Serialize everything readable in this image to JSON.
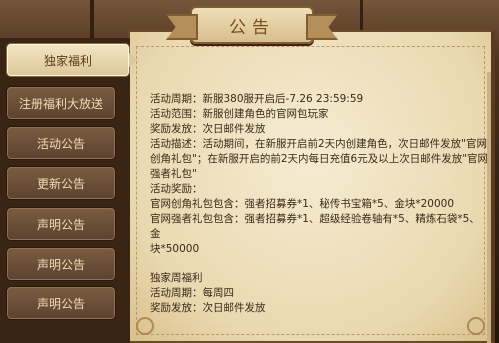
{
  "title": "公告",
  "sidebar": {
    "items": [
      {
        "label": "独家福利",
        "active": true
      },
      {
        "label": "注册福利大放送",
        "active": false
      },
      {
        "label": "活动公告",
        "active": false
      },
      {
        "label": "更新公告",
        "active": false
      },
      {
        "label": "声明公告",
        "active": false
      },
      {
        "label": "声明公告",
        "active": false
      },
      {
        "label": "声明公告",
        "active": false
      }
    ]
  },
  "content": {
    "lines": [
      "活动周期：新服380服开启后-7.26 23:59:59",
      "活动范围：新服创建角色的官网包玩家",
      "奖励发放：次日邮件发放",
      "活动描述：活动期间，在新服开启前2天内创建角色，次日邮件发放\"官网",
      "创角礼包\"；在新服开启的前2天内每日充值6元及以上次日邮件发放\"官网",
      "强者礼包\"",
      "活动奖励：",
      "官网创角礼包包含：强者招募券*1、秘传书宝箱*5、金块*20000",
      "官网强者礼包包含：强者招募券*1、超级经验卷轴有*5、精炼石袋*5、金",
      "块*50000"
    ],
    "lines2": [
      "独家周福利",
      "活动周期：每周四",
      "奖励发放：次日邮件发放"
    ]
  },
  "colors": {
    "parchment": "#ead9b0",
    "sidebar_button": "#6b4e36",
    "active_button": "#ecdcb4",
    "text": "#3a2a18"
  }
}
